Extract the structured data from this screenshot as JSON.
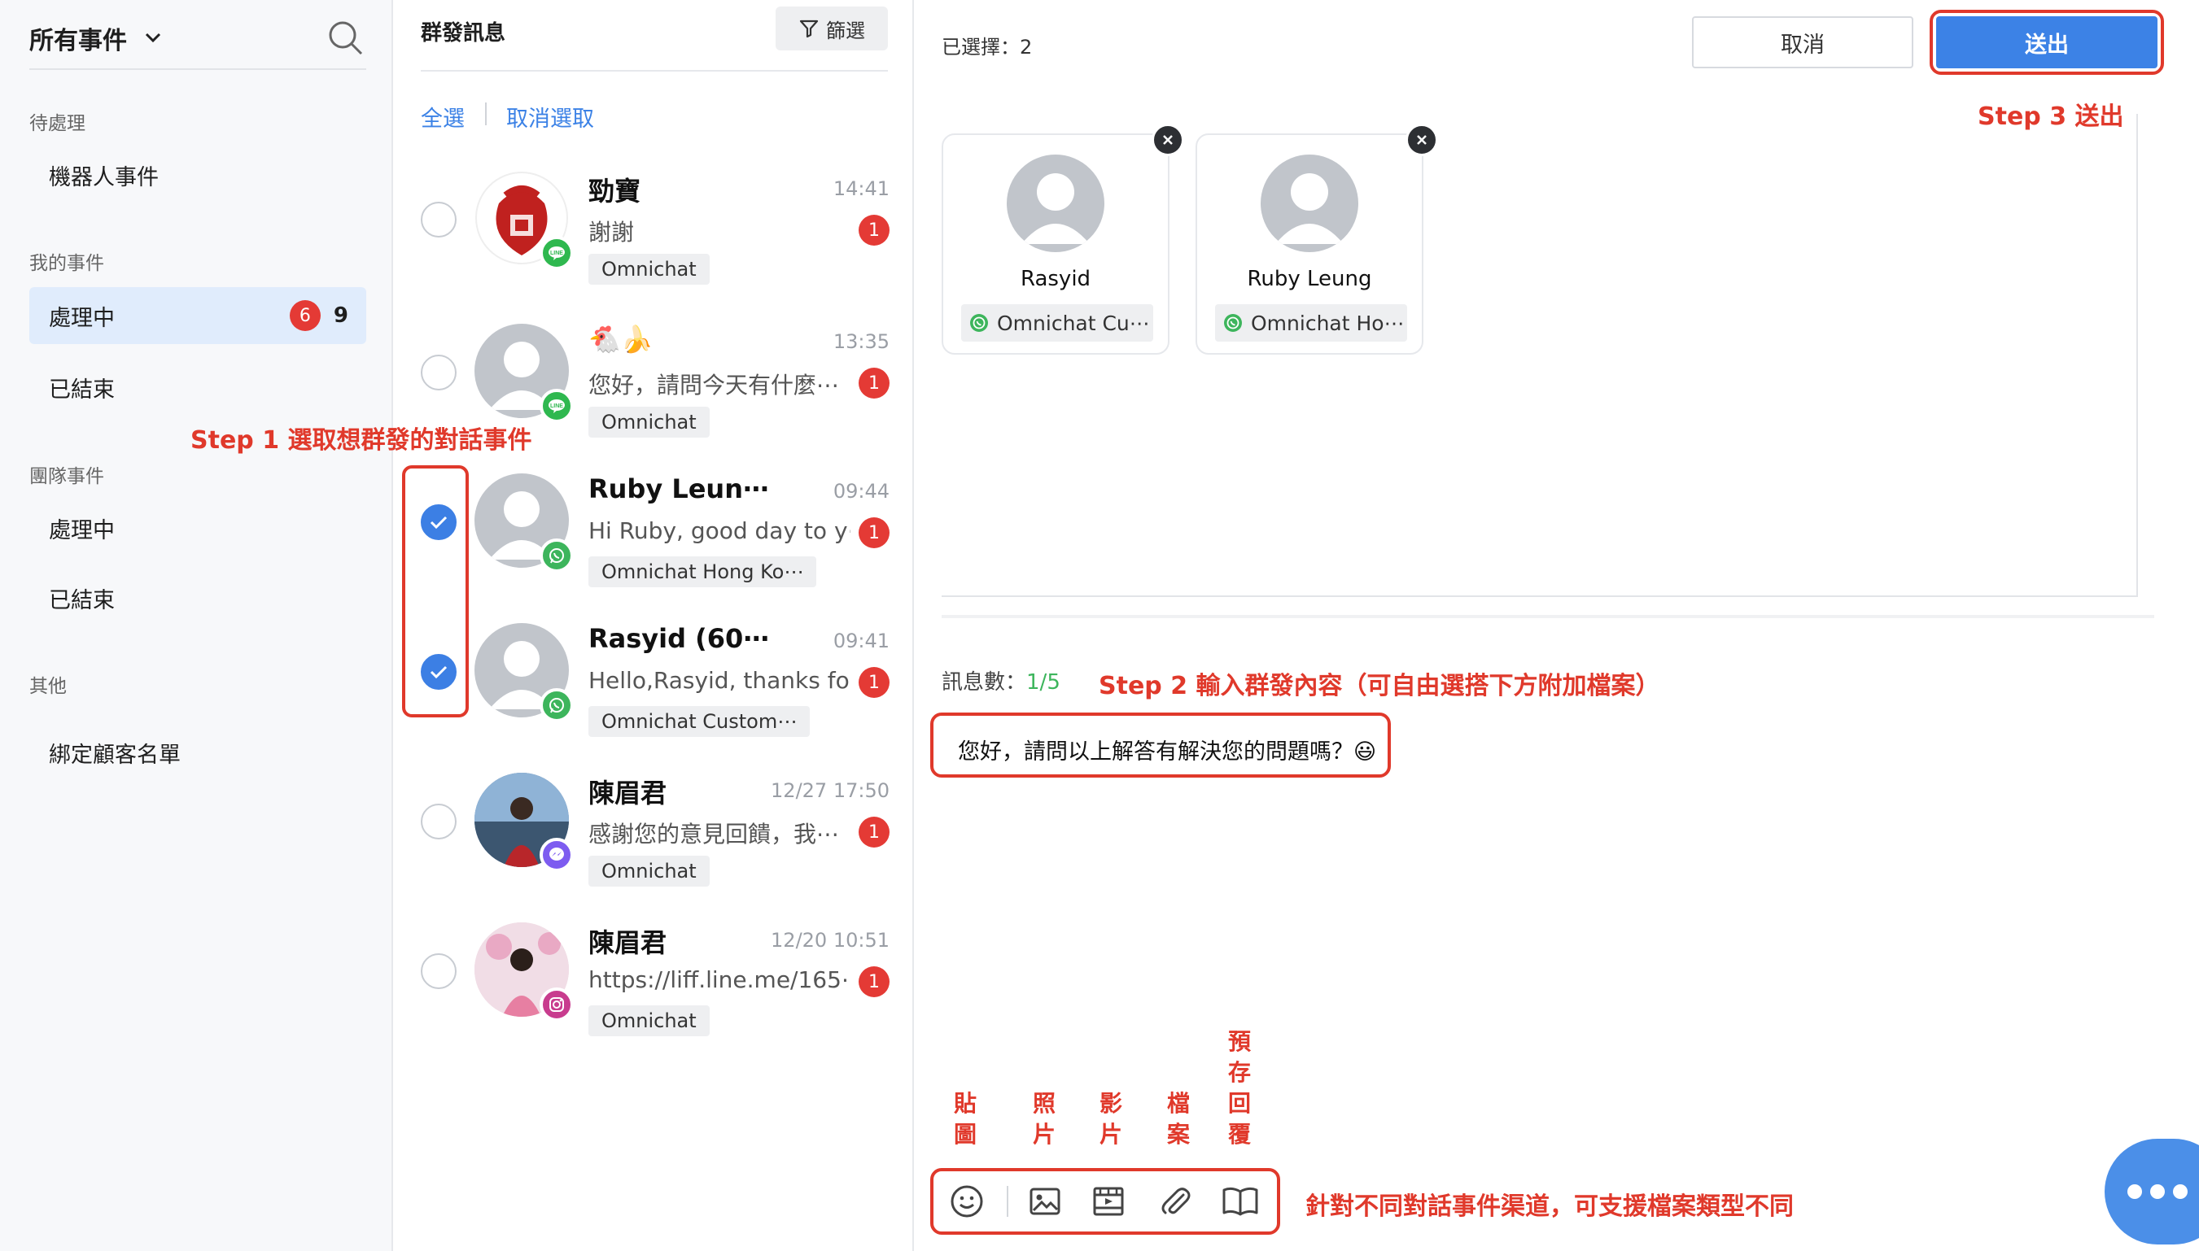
{
  "sidebar": {
    "title": "所有事件",
    "sections": {
      "pending": "待處理",
      "mine": "我的事件",
      "team": "團隊事件",
      "other": "其他"
    },
    "items": [
      {
        "label": "機器人事件"
      },
      {
        "label": "處理中",
        "badge": "6",
        "count": "9"
      },
      {
        "label": "已結束"
      },
      {
        "label": "處理中"
      },
      {
        "label": "已結束"
      },
      {
        "label": "綁定顧客名單"
      }
    ]
  },
  "list": {
    "title": "群發訊息",
    "filter_label": "篩選",
    "select_all": "全選",
    "deselect": "取消選取",
    "conversations": [
      {
        "name": "勁寶",
        "time": "14:41",
        "preview": "謝謝",
        "unread": "1",
        "tag": "Omnichat",
        "channel": "line",
        "checked": false
      },
      {
        "name": "🐔🍌",
        "time": "13:35",
        "preview": "您好，請問今天有什麼⋯",
        "unread": "1",
        "tag": "Omnichat",
        "channel": "line",
        "checked": false
      },
      {
        "name": "Ruby Leun⋯",
        "time": "09:44",
        "preview": "Hi Ruby, good day to y⋯",
        "unread": "1",
        "tag": "Omnichat Hong Ko⋯",
        "channel": "whatsapp",
        "checked": true
      },
      {
        "name": "Rasyid (60⋯",
        "time": "09:41",
        "preview": "Hello,Rasyid, thanks fo⋯",
        "unread": "1",
        "tag": "Omnichat Custom⋯",
        "channel": "whatsapp",
        "checked": true
      },
      {
        "name": "陳眉君",
        "time": "12/27 17:50",
        "preview": "感謝您的意見回饋，我⋯",
        "unread": "1",
        "tag": "Omnichat",
        "channel": "messenger",
        "checked": false
      },
      {
        "name": "陳眉君",
        "time": "12/20 10:51",
        "preview": "https://liff.line.me/165⋯",
        "unread": "1",
        "tag": "Omnichat",
        "channel": "instagram",
        "checked": false
      }
    ]
  },
  "compose": {
    "selected_count": "已選擇：2",
    "cancel_label": "取消",
    "send_label": "送出",
    "recipients": [
      {
        "name": "Rasyid",
        "tag": "Omnichat Cu⋯"
      },
      {
        "name": "Ruby Leung",
        "tag": "Omnichat Ho⋯"
      }
    ],
    "msg_count_label": "訊息數：",
    "msg_count_value": "1/5",
    "message_text": "您好，請問以上解答有解決您的問題嗎？😃",
    "tools": [
      "sticker-icon",
      "image-icon",
      "video-icon",
      "attachment-icon",
      "saved-reply-icon"
    ]
  },
  "annotations": {
    "step1": "Step 1 選取想群發的對話事件",
    "step2": "Step 2 輸入群發內容（可自由選搭下方附加檔案）",
    "step3": "Step 3 送出",
    "tool_sticker": "貼圖",
    "tool_photo": "照片",
    "tool_video": "影片",
    "tool_file": "檔案",
    "tool_saved": "預存回覆",
    "channel_note": "針對不同對話事件渠道，可支援檔案類型不同"
  },
  "colors": {
    "accent": "#3c82e6",
    "annotation": "#e0392b",
    "badge": "#e43a35",
    "active_bg": "#e0ecfc",
    "line": "#2fb84f",
    "whatsapp": "#3db55c"
  }
}
